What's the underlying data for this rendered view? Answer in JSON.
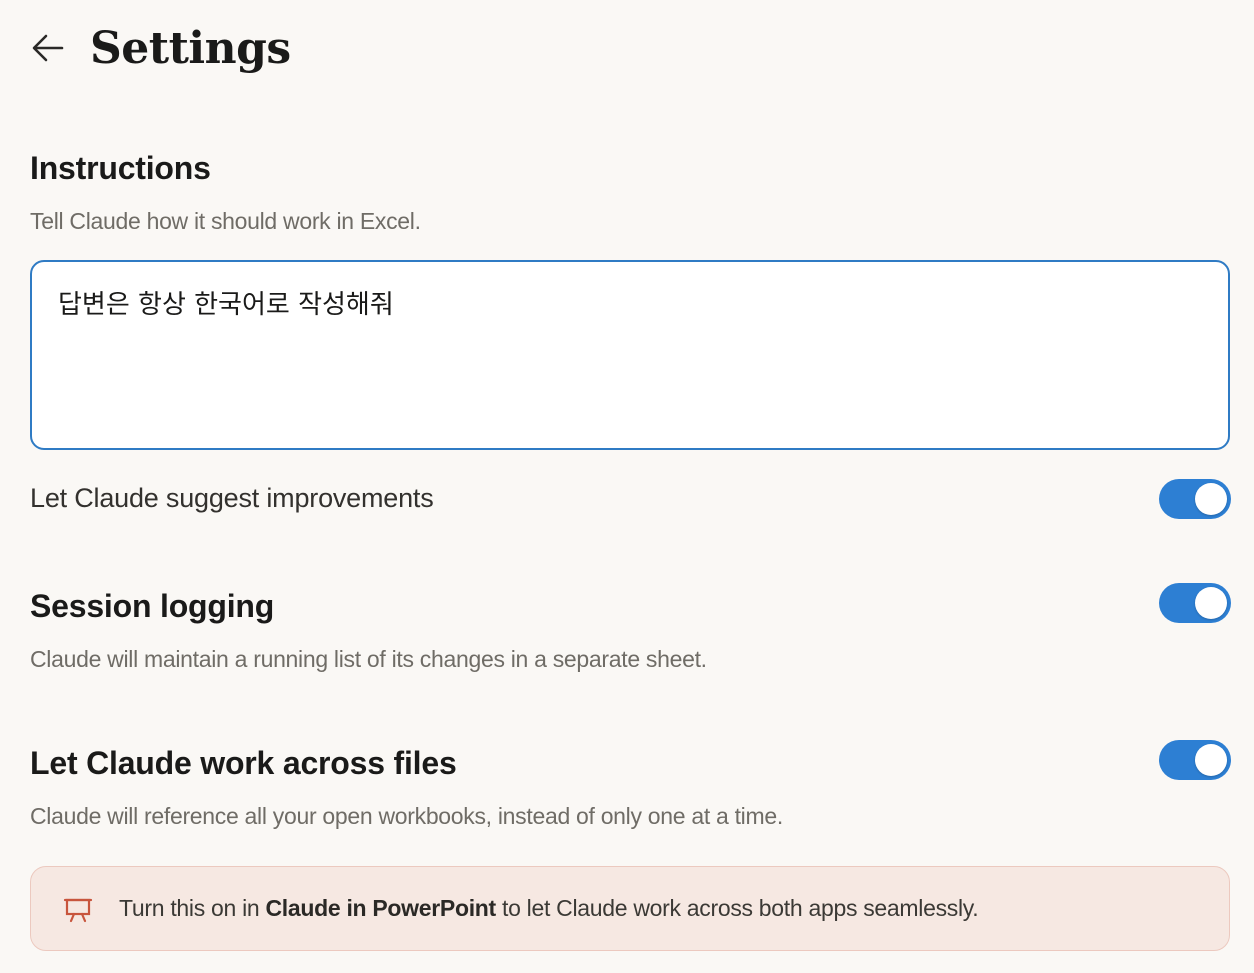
{
  "header": {
    "title": "Settings",
    "back_icon": "arrow-left-icon"
  },
  "instructions": {
    "title": "Instructions",
    "description": "Tell Claude how it should work in Excel.",
    "value": "답변은 항상 한국어로 작성해줘"
  },
  "suggest_improvements": {
    "label": "Let Claude suggest improvements",
    "enabled": true
  },
  "session_logging": {
    "title": "Session logging",
    "description": "Claude will maintain a running list of its changes in a separate sheet.",
    "enabled": true
  },
  "work_across_files": {
    "title": "Let Claude work across files",
    "description": "Claude will reference all your open workbooks, instead of only one at a time.",
    "enabled": true
  },
  "notice": {
    "icon": "presentation-icon",
    "text_before": "Turn this on in ",
    "text_bold": "Claude in PowerPoint",
    "text_after": " to let Claude work across both apps seamlessly."
  },
  "colors": {
    "background": "#faf8f5",
    "accent": "#2d7fd3",
    "notice_background": "#f6e8e2",
    "notice_icon": "#c8553d"
  }
}
